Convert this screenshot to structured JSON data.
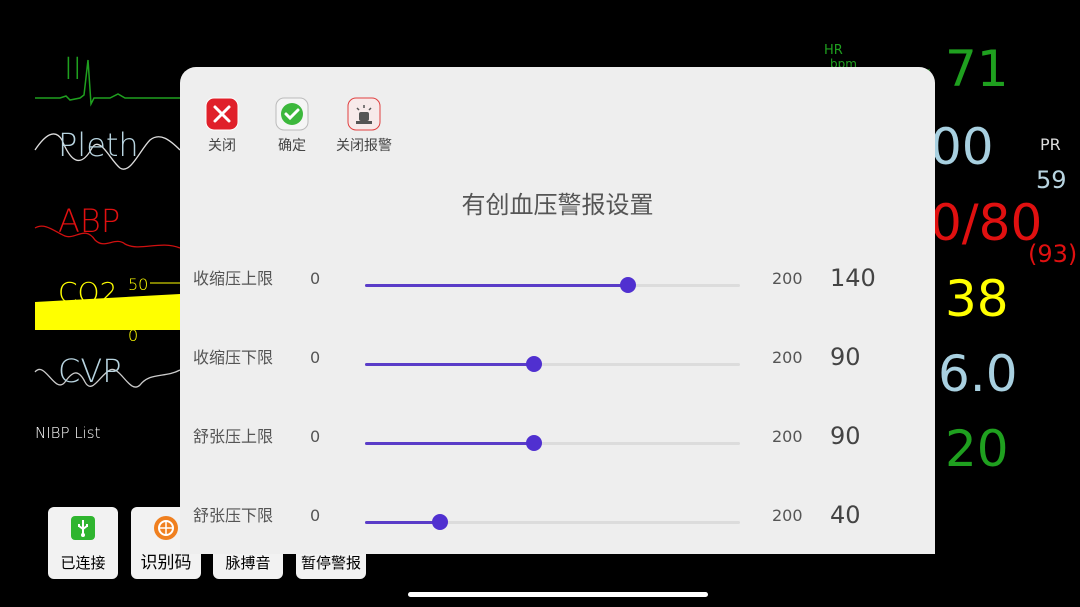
{
  "monitor": {
    "waves": {
      "ecg": "II",
      "pleth": "Pleth",
      "abp": "ABP",
      "co2": "CO2",
      "co2_scale_top": "50",
      "co2_scale_bottom": "0",
      "cvp": "CVP"
    },
    "nibp_list": "NIBP List",
    "hr_label": "HR",
    "hr_unit": "bpm",
    "hr_value": "71",
    "spo2_partial": "00",
    "pr_label": "PR",
    "pr_value": "59",
    "abp_partial": "0/80",
    "abp_mean": "(93)",
    "co2_value": "38",
    "cvp_partial": "6.0",
    "resp_value": "20",
    "colors": {
      "ecg": "#1fa01f",
      "pleth": "#9ec9dc",
      "abp": "#e01010",
      "co2": "#ffff00",
      "cvp": "#cccccc"
    }
  },
  "bottom_bar": [
    {
      "label": "已连接",
      "icon": "usb-icon"
    },
    {
      "label": "识别码",
      "icon": "qr-code-icon"
    },
    {
      "label": "脉搏音",
      "icon": "pulse-sound-icon"
    },
    {
      "label": "暂停警报",
      "icon": "alarm-pause-icon"
    }
  ],
  "dialog": {
    "title": "有创血压警报设置",
    "toolbar": {
      "close_label": "关闭",
      "confirm_label": "确定",
      "alarm_off_label": "关闭报警"
    },
    "rows": [
      {
        "name": "收缩压上限",
        "min": "0",
        "max": "200",
        "value": "140",
        "fraction": 0.7
      },
      {
        "name": "收缩压下限",
        "min": "0",
        "max": "200",
        "value": "90",
        "fraction": 0.45
      },
      {
        "name": "舒张压上限",
        "min": "0",
        "max": "200",
        "value": "90",
        "fraction": 0.45
      },
      {
        "name": "舒张压下限",
        "min": "0",
        "max": "200",
        "value": "40",
        "fraction": 0.2
      }
    ],
    "accent": "#5030d0"
  }
}
